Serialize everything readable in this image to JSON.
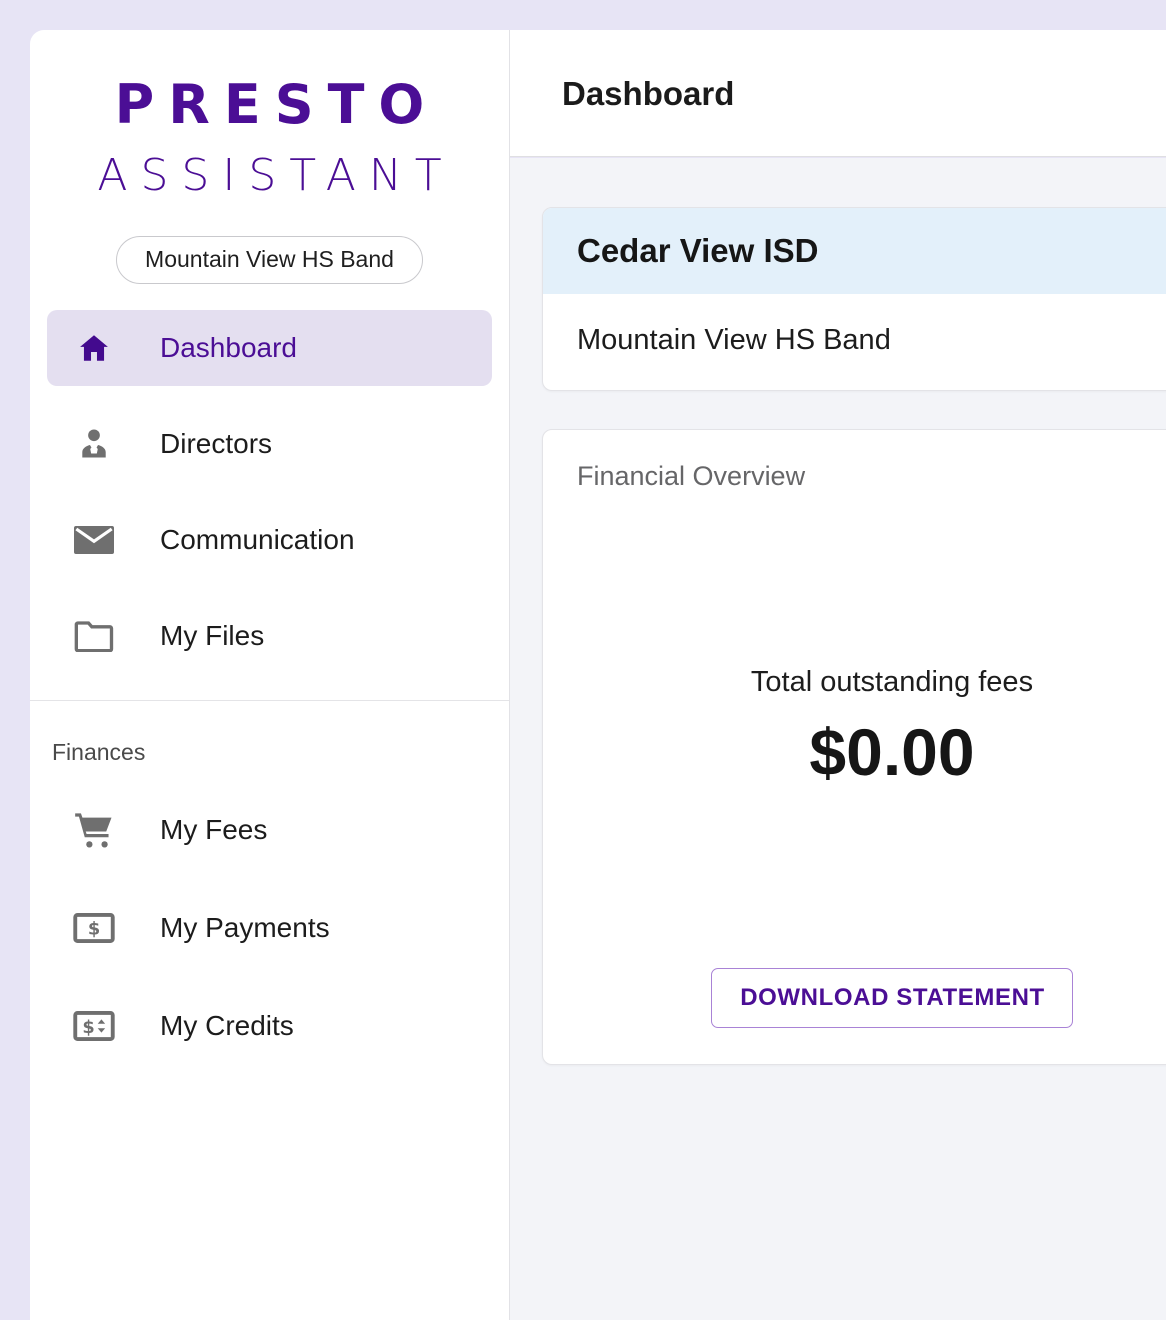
{
  "brand": {
    "logo_line1": "PRESTO",
    "logo_line2": "ASSISTANT",
    "accent_color": "#4b0e95",
    "page_background": "#e7e4f5"
  },
  "sidebar": {
    "org_pill": "Mountain View HS Band",
    "primary_items": [
      {
        "label": "Dashboard",
        "icon": "home-icon",
        "active": true
      },
      {
        "label": "Directors",
        "icon": "person-tie-icon",
        "active": false
      },
      {
        "label": "Communication",
        "icon": "envelope-icon",
        "active": false
      },
      {
        "label": "My Files",
        "icon": "folder-icon",
        "active": false
      }
    ],
    "finances_section_label": "Finances",
    "finances_items": [
      {
        "label": "My Fees",
        "icon": "shopping-cart-icon",
        "active": false
      },
      {
        "label": "My Payments",
        "icon": "banknote-dollar-icon",
        "active": false
      },
      {
        "label": "My Credits",
        "icon": "price-change-icon",
        "active": false
      }
    ]
  },
  "topbar": {
    "title": "Dashboard"
  },
  "content": {
    "org_card": {
      "header_title": "Cedar View ISD",
      "body_text": "Mountain View HS Band",
      "header_background": "#e3f0fa"
    },
    "financial_card": {
      "subtitle": "Financial Overview",
      "stat_label": "Total outstanding fees",
      "stat_value": "$0.00",
      "download_button_label": "DOWNLOAD STATEMENT"
    }
  }
}
